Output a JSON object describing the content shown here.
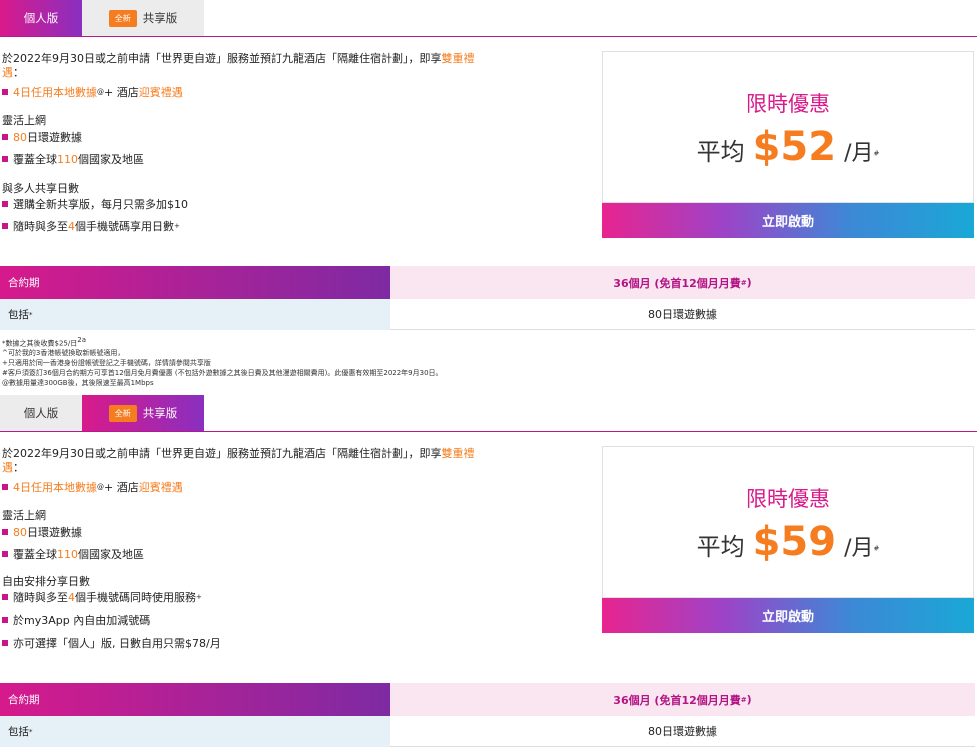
{
  "tabs": {
    "personal": "個人版",
    "new_badge": "全新",
    "shared": "共享版"
  },
  "s1": {
    "intro_a": "於2022年9月30日或之前申請「世界更自遊」服務並預訂九龍酒店「隔離住宿計劃」，即享",
    "intro_hl": "雙重禮遇",
    "intro_b": "：",
    "b1_a": "4日任用本地數據",
    "b1_sup": "@",
    "b1_b": " + 酒店",
    "b1_c": "迎賓禮遇",
    "h1": "靈活上網",
    "b2_hl": "80",
    "b2": "日環遊數據",
    "b3_a": "覆蓋全球",
    "b3_hl": "110",
    "b3_b": "個國家及地區",
    "h2": "與多人共享日數",
    "b4": "選購全新共享版，每月只需多加$10",
    "b5_a": "隨時與多至",
    "b5_hl": "4",
    "b5_b": "個手機號碼享用日數",
    "b5_sup": "+",
    "promo_title": "限時優惠",
    "avg": "平均",
    "price": "$52",
    "per": "/月",
    "per_sup": "#",
    "cta": "立即啟動",
    "term_label": "合約期",
    "term_value": "36個月 (免首12個月月費",
    "term_sup": "#",
    "term_close": ")",
    "incl_label": "包括",
    "incl_sup": "*",
    "incl_value": "80日環遊數據"
  },
  "notes": [
    "*數據之其後收費$25/日",
    "^可於我的3香港帳號換取新帳號適用，",
    "+只適用於同一香港身份證帳號登記之手機號碼，詳情請參閱共享版",
    "#客戶須簽訂36個月合約期方可享首12個月免月費優惠 (不包括外遊數據之其後日費及其他漫遊相關費用)。此優惠有效期至2022年9月30日。",
    "@數據用量達300GB後，其後限速至最高1Mbps"
  ],
  "notes_sup": "2a",
  "notes_link": "共享版",
  "s2": {
    "intro_a": "於2022年9月30日或之前申請「世界更自遊」服務並預訂九龍酒店「隔離住宿計劃」，即享",
    "intro_hl": "雙重禮遇",
    "intro_b": "：",
    "b1_a": "4日任用本地數據",
    "b1_sup": "@",
    "b1_b": " + 酒店",
    "b1_c": "迎賓禮遇",
    "h1": "靈活上網",
    "b2_hl": "80",
    "b2": "日環遊數據",
    "b3_a": "覆蓋全球",
    "b3_hl": "110",
    "b3_b": "個國家及地區",
    "h2": "自由安排分享日數",
    "b4_a": "隨時與多至",
    "b4_hl": "4",
    "b4_b": "個手機號碼同時使用服務",
    "b4_sup": "+",
    "b5": "於my3App 內自由加減號碼",
    "b6": "亦可選擇「個人」版, 日數自用只需$78/月",
    "promo_title": "限時優惠",
    "avg": "平均",
    "price": "$59",
    "per": "/月",
    "per_sup": "#",
    "cta": "立即啟動",
    "term_label": "合約期",
    "term_value": "36個月 (免首12個月月費",
    "term_sup": "#",
    "term_close": ")",
    "incl_label": "包括",
    "incl_sup": "*",
    "incl_value": "80日環遊數據"
  }
}
